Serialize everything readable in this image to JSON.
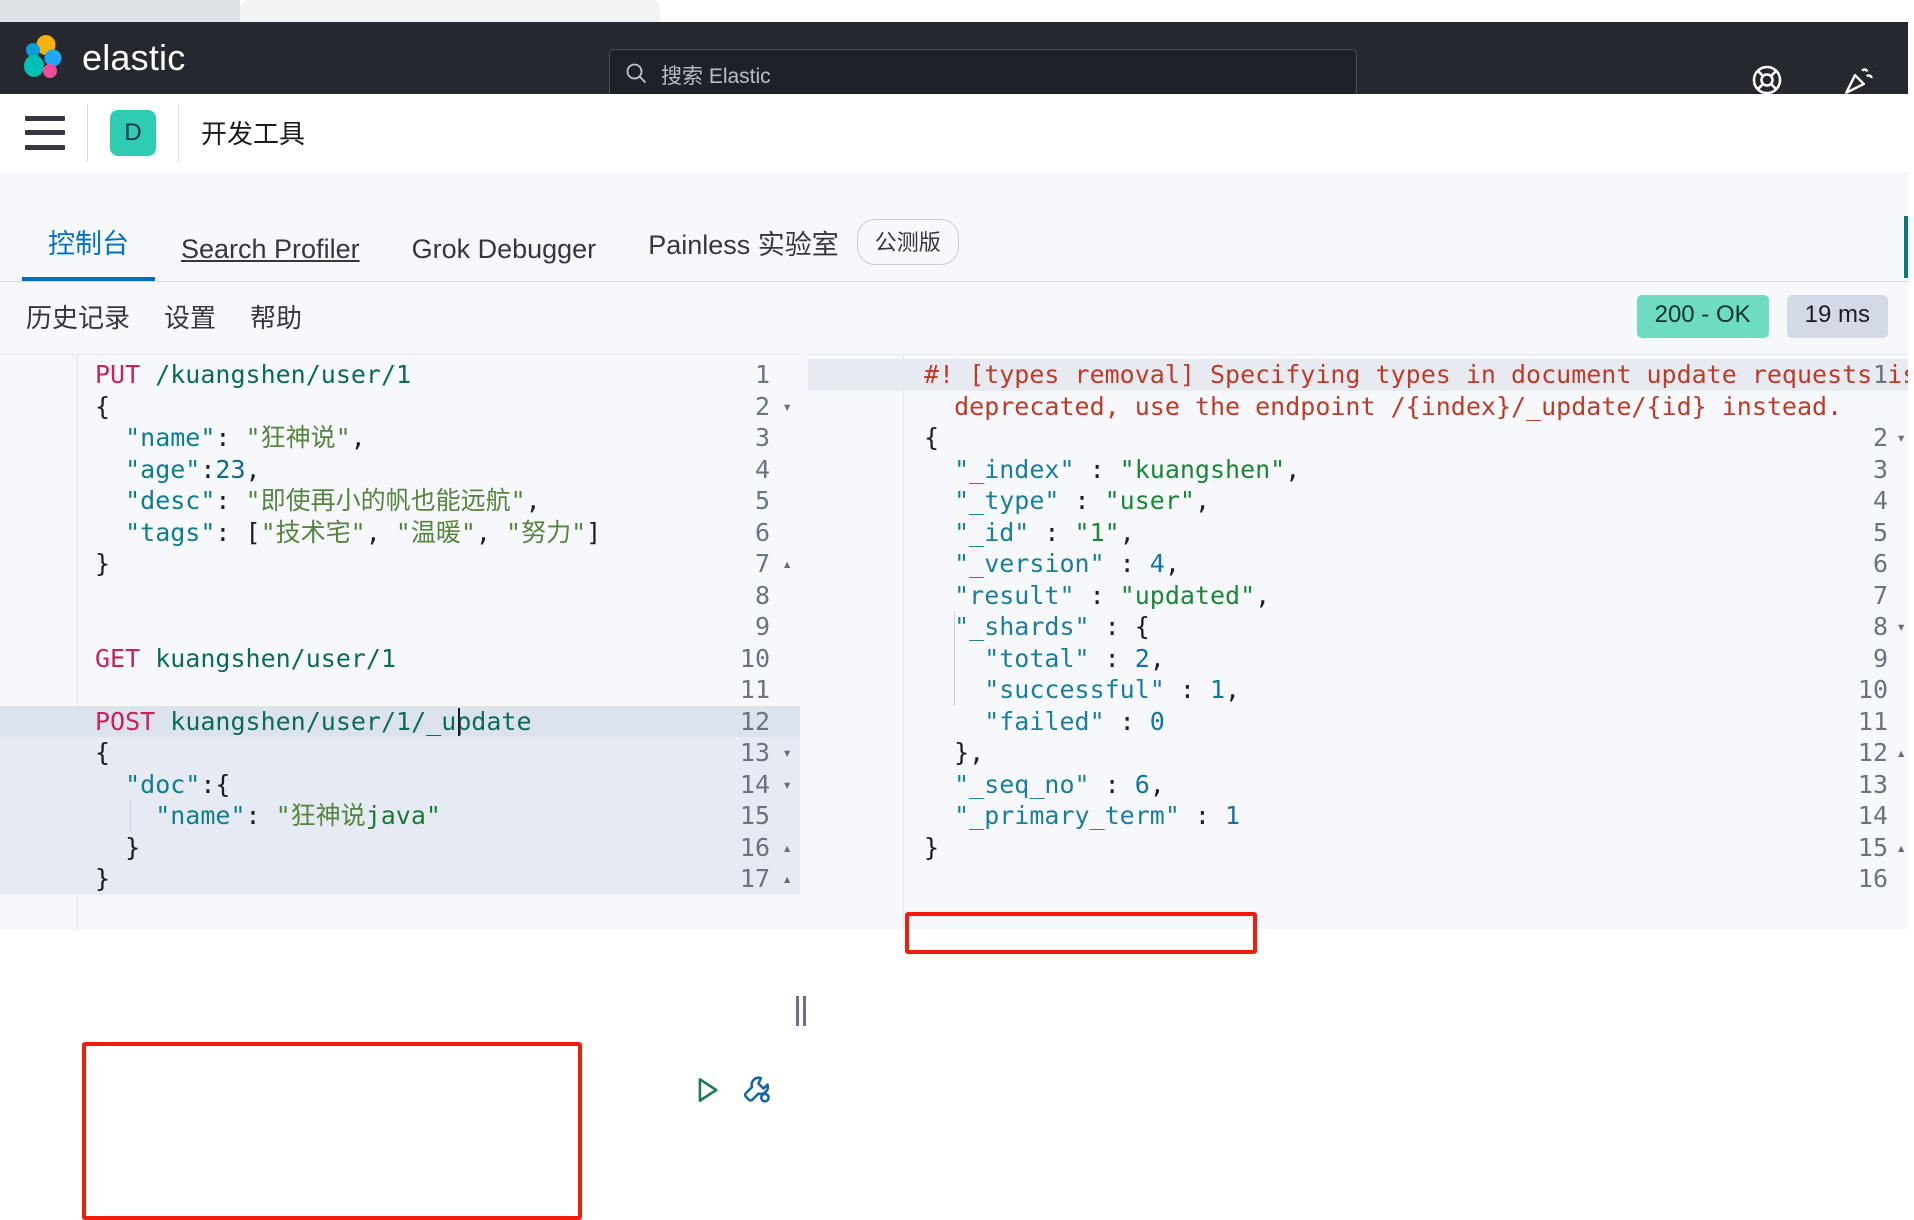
{
  "browser": {
    "tab_strip": ""
  },
  "global_nav": {
    "brand": "elastic",
    "logo_icon": "elastic-logo-icon",
    "search": {
      "placeholder": "搜索 Elastic",
      "value": "",
      "icon": "search-icon"
    },
    "icons": [
      {
        "name": "help-lifebuoy-icon",
        "label": "帮助"
      },
      {
        "name": "whats-new-party-popper-icon",
        "label": "新功能"
      }
    ]
  },
  "app_header": {
    "menu_icon": "hamburger-menu-icon",
    "space_avatar": "D",
    "title": "开发工具"
  },
  "tabs": [
    {
      "label": "控制台",
      "active": true,
      "hover": false
    },
    {
      "label": "Search Profiler",
      "active": false,
      "hover": true
    },
    {
      "label": "Grok Debugger",
      "active": false,
      "hover": false
    },
    {
      "label": "Painless 实验室",
      "active": false,
      "hover": false,
      "badge": "公测版"
    }
  ],
  "console_toolbar": {
    "links": [
      "历史记录",
      "设置",
      "帮助"
    ],
    "status_code": "200 - OK",
    "status_time": "19 ms"
  },
  "request_editor": {
    "cursor_line": 12,
    "highlighted_request_lines": [
      12,
      13,
      14,
      15,
      16,
      17
    ],
    "actions": [
      {
        "name": "play-request-icon",
        "label": "发送请求",
        "color": "#1e7b4f"
      },
      {
        "name": "wrench-icon",
        "label": "操作",
        "color": "#1765a5"
      }
    ],
    "lines": [
      {
        "n": 1,
        "fold": "",
        "tokens": [
          {
            "t": "PUT",
            "c": "k-method"
          },
          {
            "t": " /kuangshen/user/1",
            "c": "k-url"
          }
        ]
      },
      {
        "n": 2,
        "fold": "▾",
        "tokens": [
          {
            "t": "{",
            "c": "k-punct"
          }
        ]
      },
      {
        "n": 3,
        "fold": "",
        "tokens": [
          {
            "t": "  \"name\"",
            "c": "k-key"
          },
          {
            "t": ": ",
            "c": "k-punct"
          },
          {
            "t": "\"狂神说\"",
            "c": "k-cstr"
          },
          {
            "t": ",",
            "c": "k-punct"
          }
        ]
      },
      {
        "n": 4,
        "fold": "",
        "tokens": [
          {
            "t": "  \"age\"",
            "c": "k-key"
          },
          {
            "t": ":",
            "c": "k-punct"
          },
          {
            "t": "23",
            "c": "k-num"
          },
          {
            "t": ",",
            "c": "k-punct"
          }
        ]
      },
      {
        "n": 5,
        "fold": "",
        "tokens": [
          {
            "t": "  \"desc\"",
            "c": "k-key"
          },
          {
            "t": ": ",
            "c": "k-punct"
          },
          {
            "t": "\"即使再小的帆也能远航\"",
            "c": "k-cstr"
          },
          {
            "t": ",",
            "c": "k-punct"
          }
        ]
      },
      {
        "n": 6,
        "fold": "",
        "tokens": [
          {
            "t": "  \"tags\"",
            "c": "k-key"
          },
          {
            "t": ": [",
            "c": "k-punct"
          },
          {
            "t": "\"技术宅\"",
            "c": "k-cstr"
          },
          {
            "t": ", ",
            "c": "k-punct"
          },
          {
            "t": "\"温暖\"",
            "c": "k-cstr"
          },
          {
            "t": ", ",
            "c": "k-punct"
          },
          {
            "t": "\"努力\"",
            "c": "k-cstr"
          },
          {
            "t": "]",
            "c": "k-punct"
          }
        ]
      },
      {
        "n": 7,
        "fold": "▴",
        "tokens": [
          {
            "t": "}",
            "c": "k-punct"
          }
        ]
      },
      {
        "n": 8,
        "fold": "",
        "tokens": []
      },
      {
        "n": 9,
        "fold": "",
        "tokens": []
      },
      {
        "n": 10,
        "fold": "",
        "tokens": [
          {
            "t": "GET",
            "c": "k-method"
          },
          {
            "t": " kuangshen/user/1",
            "c": "k-url"
          }
        ]
      },
      {
        "n": 11,
        "fold": "",
        "tokens": []
      },
      {
        "n": 12,
        "fold": "",
        "tokens": [
          {
            "t": "POST",
            "c": "k-method"
          },
          {
            "t": " kuangshen/user/1/_update",
            "c": "k-url"
          }
        ]
      },
      {
        "n": 13,
        "fold": "▾",
        "tokens": [
          {
            "t": "{",
            "c": "k-punct"
          }
        ]
      },
      {
        "n": 14,
        "fold": "▾",
        "tokens": [
          {
            "t": "  \"doc\"",
            "c": "k-key"
          },
          {
            "t": ":{",
            "c": "k-punct"
          }
        ]
      },
      {
        "n": 15,
        "fold": "",
        "tokens": [
          {
            "t": "    \"name\"",
            "c": "k-key"
          },
          {
            "t": ": ",
            "c": "k-punct"
          },
          {
            "t": "\"狂神说",
            "c": "k-cstr"
          },
          {
            "t": "java\"",
            "c": "k-str"
          }
        ]
      },
      {
        "n": 16,
        "fold": "▴",
        "tokens": [
          {
            "t": "  }",
            "c": "k-punct"
          }
        ]
      },
      {
        "n": 17,
        "fold": "▴",
        "tokens": [
          {
            "t": "}",
            "c": "k-punct"
          }
        ]
      }
    ]
  },
  "response_editor": {
    "warning_lines": [
      1
    ],
    "lines": [
      {
        "n": 1,
        "fold": "",
        "tokens": [
          {
            "t": "#! [types removal] Specifying types in document update requests is",
            "c": "k-warn"
          }
        ]
      },
      {
        "n": "",
        "fold": "",
        "tokens": [
          {
            "t": "  deprecated, use the endpoint /{index}/_update/{id} instead.",
            "c": "k-warn"
          }
        ]
      },
      {
        "n": 2,
        "fold": "▾",
        "tokens": [
          {
            "t": "{",
            "c": "k-punct"
          }
        ]
      },
      {
        "n": 3,
        "fold": "",
        "tokens": [
          {
            "t": "  \"_index\"",
            "c": "k-rkey"
          },
          {
            "t": " : ",
            "c": "k-punct"
          },
          {
            "t": "\"kuangshen\"",
            "c": "k-rstr"
          },
          {
            "t": ",",
            "c": "k-punct"
          }
        ]
      },
      {
        "n": 4,
        "fold": "",
        "tokens": [
          {
            "t": "  \"_type\"",
            "c": "k-rkey"
          },
          {
            "t": " : ",
            "c": "k-punct"
          },
          {
            "t": "\"user\"",
            "c": "k-rstr"
          },
          {
            "t": ",",
            "c": "k-punct"
          }
        ]
      },
      {
        "n": 5,
        "fold": "",
        "tokens": [
          {
            "t": "  \"_id\"",
            "c": "k-rkey"
          },
          {
            "t": " : ",
            "c": "k-punct"
          },
          {
            "t": "\"1\"",
            "c": "k-rstr"
          },
          {
            "t": ",",
            "c": "k-punct"
          }
        ]
      },
      {
        "n": 6,
        "fold": "",
        "tokens": [
          {
            "t": "  \"_version\"",
            "c": "k-rkey"
          },
          {
            "t": " : ",
            "c": "k-punct"
          },
          {
            "t": "4",
            "c": "k-rnum"
          },
          {
            "t": ",",
            "c": "k-punct"
          }
        ]
      },
      {
        "n": 7,
        "fold": "",
        "tokens": [
          {
            "t": "  \"result\"",
            "c": "k-rkey"
          },
          {
            "t": " : ",
            "c": "k-punct"
          },
          {
            "t": "\"updated\"",
            "c": "k-rstr"
          },
          {
            "t": ",",
            "c": "k-punct"
          }
        ]
      },
      {
        "n": 8,
        "fold": "▾",
        "tokens": [
          {
            "t": "  \"_shards\"",
            "c": "k-rkey"
          },
          {
            "t": " : {",
            "c": "k-punct"
          }
        ]
      },
      {
        "n": 9,
        "fold": "",
        "tokens": [
          {
            "t": "    \"total\"",
            "c": "k-rkey"
          },
          {
            "t": " : ",
            "c": "k-punct"
          },
          {
            "t": "2",
            "c": "k-rnum"
          },
          {
            "t": ",",
            "c": "k-punct"
          }
        ]
      },
      {
        "n": 10,
        "fold": "",
        "tokens": [
          {
            "t": "    \"successful\"",
            "c": "k-rkey"
          },
          {
            "t": " : ",
            "c": "k-punct"
          },
          {
            "t": "1",
            "c": "k-rnum"
          },
          {
            "t": ",",
            "c": "k-punct"
          }
        ]
      },
      {
        "n": 11,
        "fold": "",
        "tokens": [
          {
            "t": "    \"failed\"",
            "c": "k-rkey"
          },
          {
            "t": " : ",
            "c": "k-punct"
          },
          {
            "t": "0",
            "c": "k-rnum"
          }
        ]
      },
      {
        "n": 12,
        "fold": "▴",
        "tokens": [
          {
            "t": "  },",
            "c": "k-punct"
          }
        ]
      },
      {
        "n": 13,
        "fold": "",
        "tokens": [
          {
            "t": "  \"_seq_no\"",
            "c": "k-rkey"
          },
          {
            "t": " : ",
            "c": "k-punct"
          },
          {
            "t": "6",
            "c": "k-rnum"
          },
          {
            "t": ",",
            "c": "k-punct"
          }
        ]
      },
      {
        "n": 14,
        "fold": "",
        "tokens": [
          {
            "t": "  \"_primary_term\"",
            "c": "k-rkey"
          },
          {
            "t": " : ",
            "c": "k-punct"
          },
          {
            "t": "1",
            "c": "k-rnum"
          }
        ]
      },
      {
        "n": 15,
        "fold": "▴",
        "tokens": [
          {
            "t": "}",
            "c": "k-punct"
          }
        ]
      },
      {
        "n": 16,
        "fold": "",
        "tokens": []
      }
    ]
  },
  "annotations": [
    {
      "name": "annot-request-block",
      "color": "#f21c0d"
    },
    {
      "name": "annot-version-field",
      "color": "#f21c0d"
    }
  ]
}
